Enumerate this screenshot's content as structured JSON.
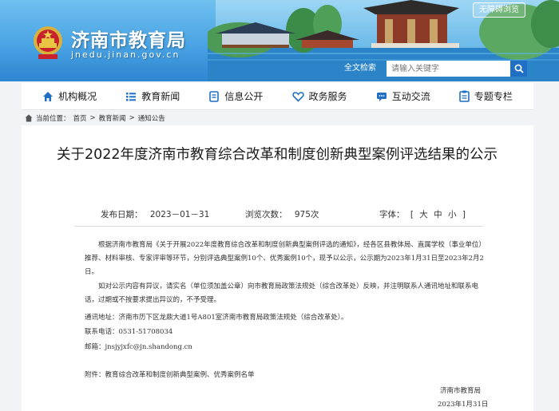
{
  "header": {
    "site_title": "济南市教育局",
    "site_domain": "jnedu.jinan.gov.cn",
    "accessibility_label": "无障碍浏览",
    "search": {
      "label": "全文检索",
      "placeholder": "请输入关键字"
    }
  },
  "nav": {
    "items": [
      {
        "label": "机构概况",
        "icon": "home-icon"
      },
      {
        "label": "教育新闻",
        "icon": "list-icon"
      },
      {
        "label": "信息公开",
        "icon": "document-icon"
      },
      {
        "label": "政务服务",
        "icon": "heart-icon"
      },
      {
        "label": "互动交流",
        "icon": "chat-icon"
      },
      {
        "label": "专题专栏",
        "icon": "clipboard-icon"
      }
    ]
  },
  "breadcrumb": {
    "prefix": "当前位置：",
    "items": [
      "首页",
      "教育新闻",
      "通知公告"
    ],
    "separator": ">"
  },
  "article": {
    "title": "关于2022年度济南市教育综合改革和制度创新典型案例评选结果的公示",
    "publish_date_label": "发布日期：",
    "publish_date": "2023－01－31",
    "views_label": "浏览次数：",
    "views": "975次",
    "font_label": "字体：",
    "font_sizes": [
      "[",
      "大",
      "中",
      "小",
      "]"
    ],
    "paragraph1": "根据济南市教育局《关于开展2022年度教育综合改革和制度创新典型案例评选的通知》，经各区县教体局、直属学校（事业单位）推荐、材料审核、专家评审等环节，分别评选典型案例10个、优秀案例10个，现予以公示，公示期为2023年1月31日至2023年2月2日。",
    "paragraph2": "如对公示内容有异议，请实名（单位须加盖公章）向市教育局政策法规处（综合改革处）反映，并注明联系人通讯地址和联系电话，过期或不按要求提出异议的，不予受理。",
    "address": "通讯地址：济南市历下区龙鼎大道1号A801室济南市教育局政策法规处（综合改革处）。",
    "phone": "联系电话：0531-51708034",
    "email": "邮箱：jnsjyjxfc@jn.shandong.cn",
    "attachment": "附件：教育综合改革和制度创新典型案例、优秀案例名单",
    "signature": "济南市教育局",
    "signature_date": "2023年1月31日"
  },
  "colors": {
    "banner_blue": "#4aa3e3",
    "search_button": "#1f6fc4",
    "nav_icon": "#1f6fc4"
  }
}
